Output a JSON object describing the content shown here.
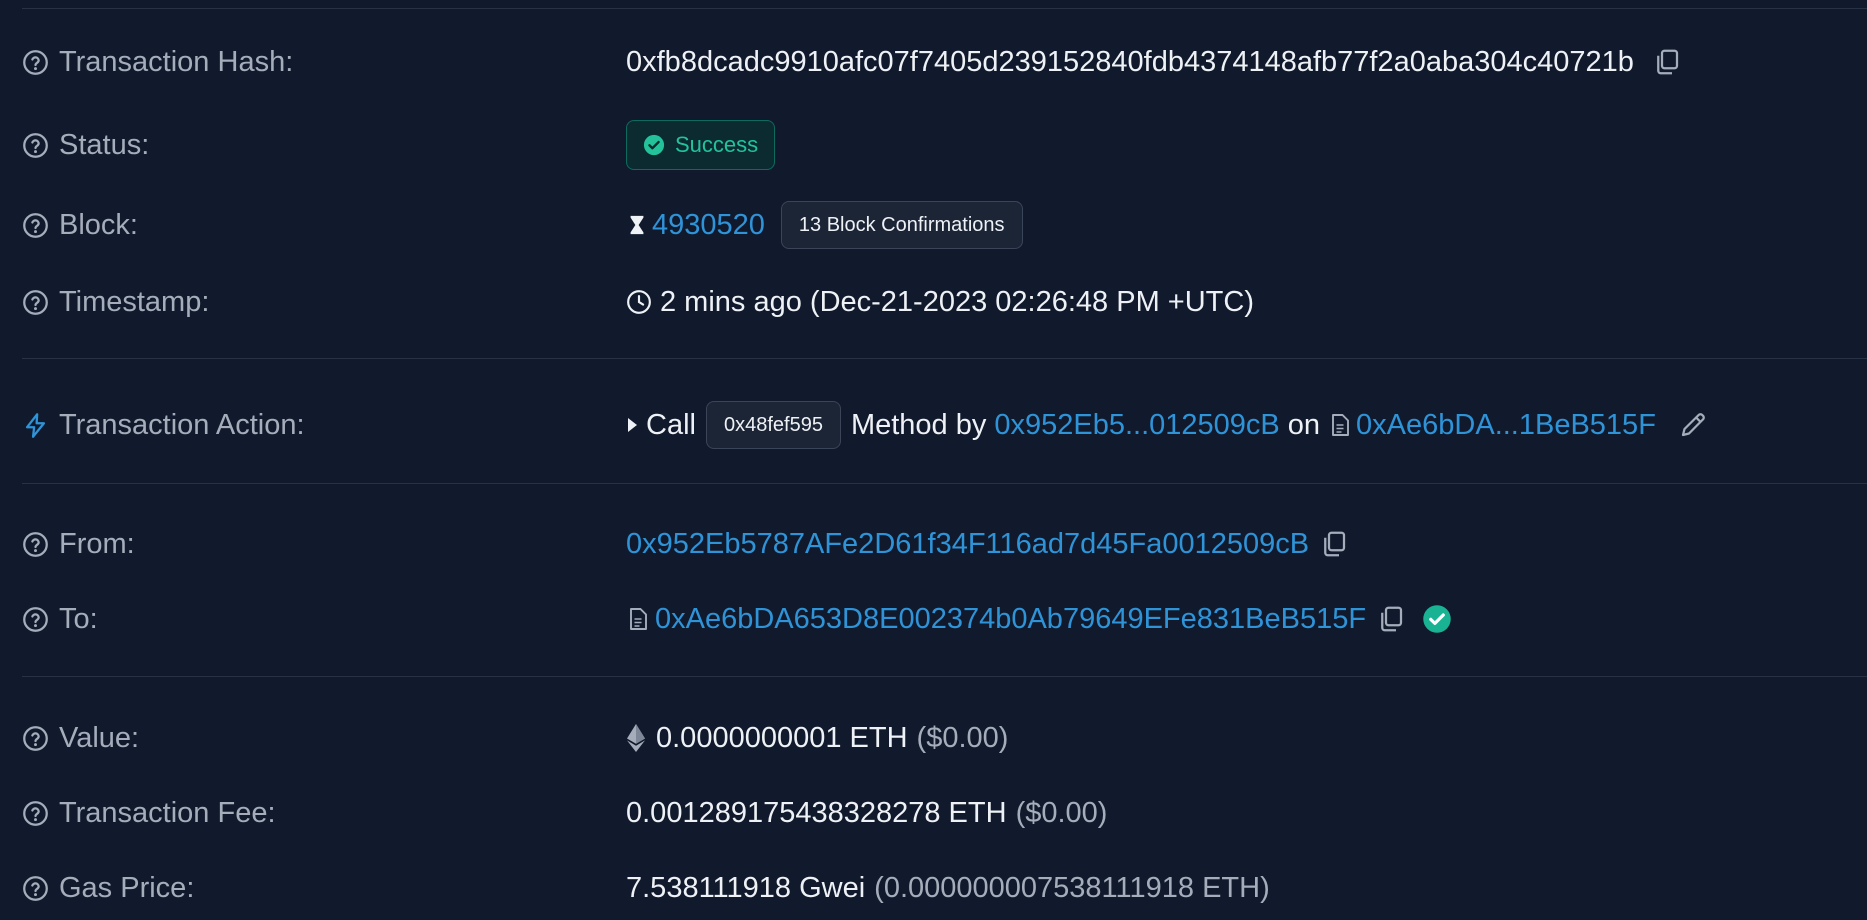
{
  "rows": {
    "hash": {
      "label": "Transaction Hash:",
      "value": "0xfb8dcadc9910afc07f7405d239152840fdb4374148afb77f2a0aba304c40721b"
    },
    "status": {
      "label": "Status:",
      "value": "Success"
    },
    "block": {
      "label": "Block:",
      "number": "4930520",
      "confirmations": "13 Block Confirmations"
    },
    "timestamp": {
      "label": "Timestamp:",
      "value": "2 mins ago (Dec-21-2023 02:26:48 PM +UTC)"
    },
    "action": {
      "label": "Transaction Action:",
      "call": "Call",
      "method_id": "0x48fef595",
      "method_by": "Method by",
      "caller": "0x952Eb5...012509cB",
      "on": "on",
      "contract": "0xAe6bDA...1BeB515F"
    },
    "from": {
      "label": "From:",
      "address": "0x952Eb5787AFe2D61f34F116ad7d45Fa0012509cB"
    },
    "to": {
      "label": "To:",
      "address": "0xAe6bDA653D8E002374b0Ab79649EFe831BeB515F"
    },
    "value": {
      "label": "Value:",
      "amount": "0.0000000001 ETH",
      "usd": "($0.00)"
    },
    "fee": {
      "label": "Transaction Fee:",
      "amount": "0.001289175438328278 ETH",
      "usd": "($0.00)"
    },
    "gas": {
      "label": "Gas Price:",
      "gwei": "7.538111918 Gwei",
      "eth": "(0.000000007538111918 ETH)"
    }
  },
  "icons": {
    "help": "question-circle-icon",
    "copy": "copy-icon",
    "success": "check-circle-icon",
    "block": "hourglass-icon",
    "clock": "clock-icon",
    "action": "lightning-icon",
    "expand": "caret-right-icon",
    "contract": "document-icon",
    "edit": "pencil-icon",
    "verified": "verified-check-icon",
    "eth": "ethereum-icon"
  },
  "colors": {
    "background": "#111a2c",
    "label": "#a5adbb",
    "text": "#eef1f5",
    "link": "#2f93d8",
    "success": "#23c29b",
    "divider": "#273246"
  }
}
